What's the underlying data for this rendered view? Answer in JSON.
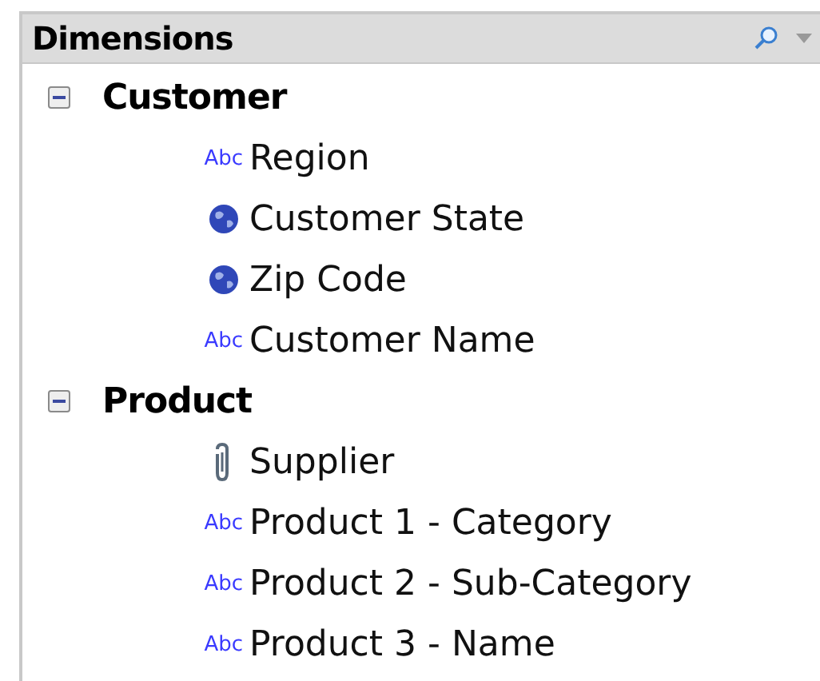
{
  "panel": {
    "title": "Dimensions"
  },
  "tree": [
    {
      "label": "Customer",
      "expanded": true,
      "children": [
        {
          "kind": "text",
          "badge": "Abc",
          "label": "Region"
        },
        {
          "kind": "geo",
          "label": "Customer State"
        },
        {
          "kind": "geo",
          "label": "Zip Code"
        },
        {
          "kind": "text",
          "badge": "Abc",
          "label": "Customer Name"
        }
      ]
    },
    {
      "label": "Product",
      "expanded": true,
      "children": [
        {
          "kind": "attachment",
          "label": "Supplier"
        },
        {
          "kind": "text",
          "badge": "Abc",
          "label": "Product 1 - Category"
        },
        {
          "kind": "text",
          "badge": "Abc",
          "label": "Product 2 - Sub-Category"
        },
        {
          "kind": "text",
          "badge": "Abc",
          "label": "Product 3 - Name"
        }
      ]
    }
  ]
}
